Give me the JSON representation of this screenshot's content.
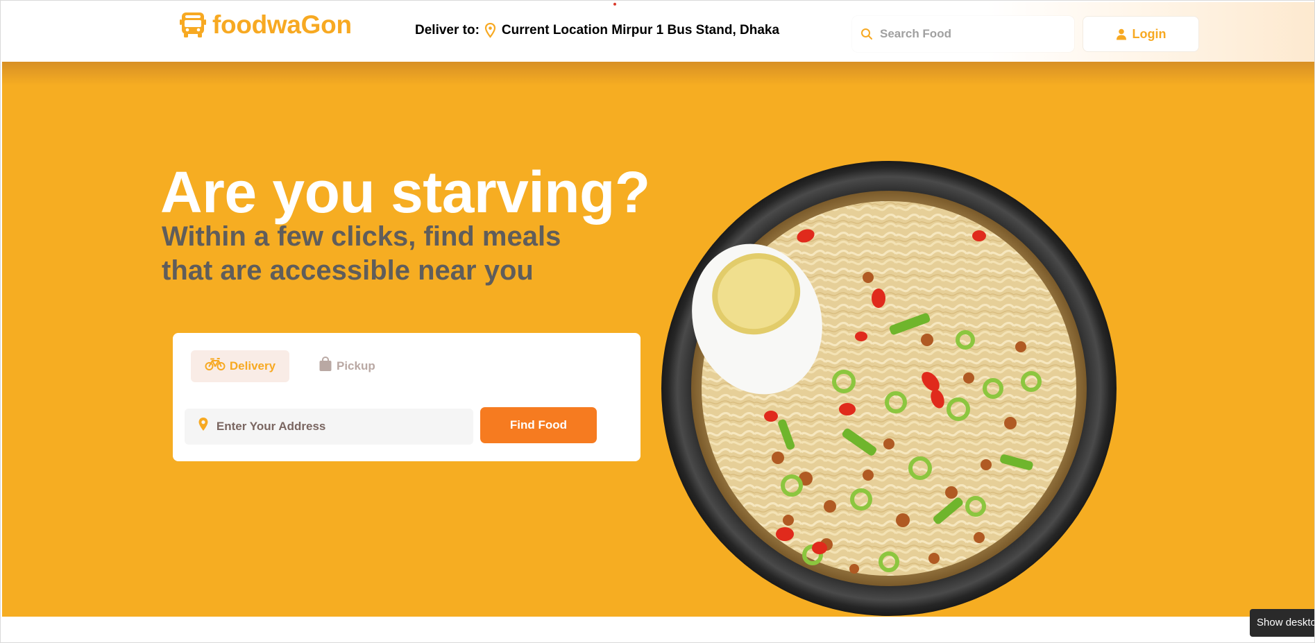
{
  "header": {
    "brand": "foodwaGon",
    "deliver_label": "Deliver to:",
    "location": "Current Location Mirpur 1 Bus Stand, Dhaka",
    "search_placeholder": "Search Food",
    "login_label": "Login"
  },
  "hero": {
    "title": "Are you starving?",
    "subtitle_line1": "Within a few clicks, find meals",
    "subtitle_line2": "that are accessible near you"
  },
  "order_card": {
    "tabs": [
      {
        "label": "Delivery",
        "icon": "bicycle-icon",
        "active": true
      },
      {
        "label": "Pickup",
        "icon": "shopping-bag-icon",
        "active": false
      }
    ],
    "address_placeholder": "Enter Your Address",
    "find_button": "Find Food"
  },
  "tooltip": {
    "text": "Show deskto"
  },
  "colors": {
    "brand": "#f7a922",
    "hero_background": "#f6ad22",
    "find_button": "#f67b20",
    "subtitle": "#5f5d5b"
  }
}
